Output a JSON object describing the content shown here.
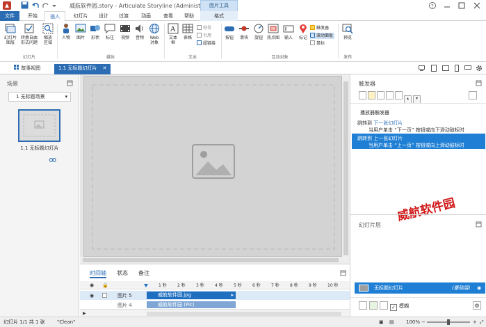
{
  "window": {
    "title": "威航软件园.story - Articulate Storyline (Administrator)",
    "context_tool": "图片工具"
  },
  "tabs": [
    {
      "label": "文件"
    },
    {
      "label": "开始"
    },
    {
      "label": "插入"
    },
    {
      "label": "幻灯片"
    },
    {
      "label": "设计"
    },
    {
      "label": "过渡"
    },
    {
      "label": "动画"
    },
    {
      "label": "查看"
    },
    {
      "label": "帮助"
    },
    {
      "label": "格式"
    }
  ],
  "ribbon": {
    "slides": {
      "btn1": "幻灯片",
      "btn1b": "图层",
      "btn2": "转换自由",
      "btn2b": "形式问题",
      "btn3": "缩放",
      "btn3b": "区域",
      "group": "幻灯片"
    },
    "media": {
      "character": "人物",
      "picture": "图片",
      "shape": "形状",
      "caption": "标注",
      "video": "视频",
      "audio": "音频",
      "web": "Web",
      "webb": "对象",
      "group": "媒体"
    },
    "text": {
      "textbox": "文本",
      "textboxb": "框",
      "table": "表格",
      "symbol": "符号",
      "reference": "引用",
      "hyperlink": "超链接",
      "group": "文本"
    },
    "interactive": {
      "button": "按钮",
      "slider": "滑块",
      "dial": "旋钮",
      "hotspot": "热点图",
      "input": "输入",
      "marker": "标记",
      "trigger": "触发器",
      "scroll": "滚动面板",
      "more": "鼠标",
      "group": "互动对象"
    },
    "publish": {
      "preview": "预览",
      "group": "发布"
    }
  },
  "docbar": {
    "story_view": "故事视图",
    "slide_tab": "1.1 无标题幻灯片"
  },
  "scenes": {
    "title": "场景",
    "selector": "1 无标题场景",
    "slide_label": "1.1 无标题幻灯片"
  },
  "canvas": {
    "image_alt": "图片 5"
  },
  "timeline": {
    "tabs": [
      "时间轴",
      "状态",
      "备注"
    ],
    "ticks": [
      "1 秒",
      "2 秒",
      "3 秒",
      "4 秒",
      "5 秒",
      "6 秒",
      "7 秒",
      "8 秒",
      "9 秒",
      "10 秒"
    ],
    "rows": [
      {
        "name": "图片 5",
        "bar": "威航软件园.jpg"
      },
      {
        "name": "图片 4",
        "bar": "威航软件园 (Pic)"
      }
    ]
  },
  "triggers": {
    "title": "触发器",
    "section": "播放器触发器",
    "items": [
      {
        "action": "跳转到",
        "target": "下一张幻灯片",
        "condition": "当用户单击 “下一页” 按钮或向下滑动鼓标时"
      },
      {
        "action": "跳转到",
        "target": "上一张幻灯片",
        "condition": "当用户单击 “上一页” 按钮或向上滑动鼓标时"
      }
    ]
  },
  "layers": {
    "title": "幻灯片层",
    "base": "无标题幻灯片",
    "base_tag": "(基础层)",
    "edit": "模糊"
  },
  "watermark": "威航软件园",
  "status": {
    "slide": "幻灯片 1/1 共 1 张",
    "theme": "\"Clean\"",
    "zoom": "100%"
  },
  "colors": {
    "accent": "#2b6cb3",
    "selected": "#1f7fd4",
    "tab_active": "#2b6cb3",
    "watermark": "#d01818",
    "bar": "#1f6fc0"
  }
}
